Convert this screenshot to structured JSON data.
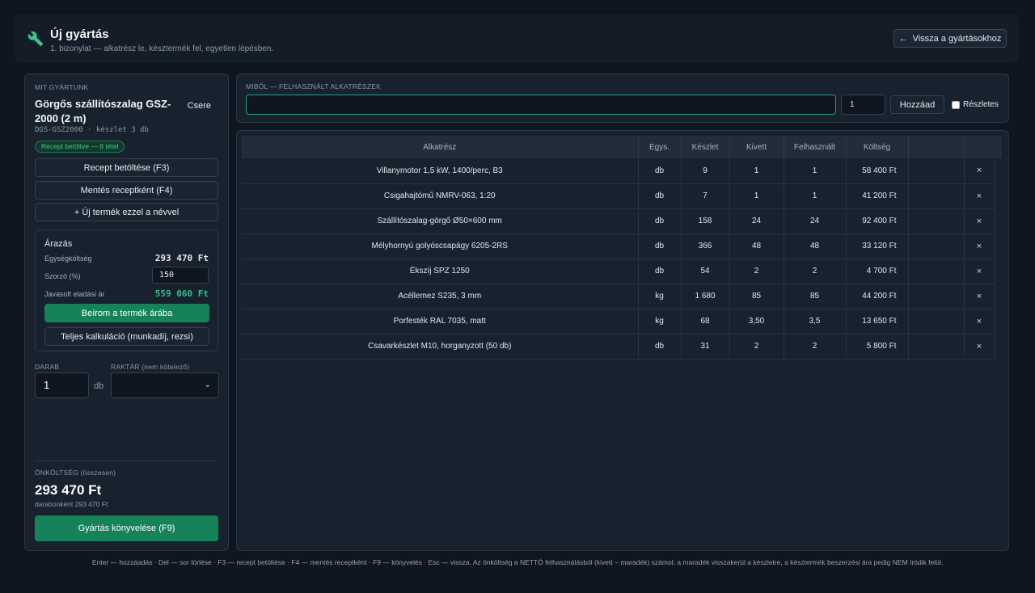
{
  "header": {
    "title": "Új gyártás",
    "subtitle": "1. bizonylat — alkatrész le, késztermék fel, egyetlen lépésben.",
    "back_label": "Vissza a gyártásokhoz"
  },
  "product": {
    "section_label": "MIT GYÁRTUNK",
    "name": "Görgős szállítószalag GSZ-2000 (2 m)",
    "change_label": "Csere",
    "code_line": "DGS-GSZ2000 · készlet 3 db",
    "badge": "Recept betöltve — 8 tétel"
  },
  "actions": {
    "load_recipe": "Recept betöltése (F3)",
    "save_recipe": "Mentés receptként (F4)",
    "new_product": "+ Új termék ezzel a névvel"
  },
  "pricing": {
    "title": "Árazás",
    "unit_cost_label": "Egységköltség",
    "unit_cost": "293 470 Ft",
    "multiplier_label": "Szorzó (%)",
    "multiplier": "150",
    "suggested_label": "Javasolt eladási ár",
    "suggested": "559 060 Ft",
    "apply_label": "Beírom a termék árába",
    "full_calc_label": "Teljes kalkuláció (munkadíj, rezsi)"
  },
  "quantity": {
    "label": "DARAB",
    "value": "1",
    "unit": "db",
    "warehouse_label": "RAKTÁR (nem kötelező)"
  },
  "summary": {
    "label": "ÖNKÖLTSÉG (összesen)",
    "total": "293 470 Ft",
    "per_unit": "darabonként 293 470 Ft",
    "post_label": "Gyártás könyvelése (F9)"
  },
  "parts": {
    "label": "MIBŐL — FELHASZNÁLT ALKATRÉSZEK",
    "qty": "1",
    "add_label": "Hozzáad",
    "detail_label": "Részletes"
  },
  "table": {
    "columns": [
      "Alkatrész",
      "Egys.",
      "Készlet",
      "Kivett",
      "Felhasznált",
      "Költség"
    ],
    "rows": [
      {
        "name": "Villanymotor 1,5 kW, 1400/perc, B3",
        "unit": "db",
        "stock": "9",
        "taken": "1",
        "used": "1",
        "cost": "58 400 Ft"
      },
      {
        "name": "Csigahajtómű NMRV-063, 1:20",
        "unit": "db",
        "stock": "7",
        "taken": "1",
        "used": "1",
        "cost": "41 200 Ft"
      },
      {
        "name": "Szállítószalag-görgő Ø50×600 mm",
        "unit": "db",
        "stock": "158",
        "taken": "24",
        "used": "24",
        "cost": "92 400 Ft"
      },
      {
        "name": "Mélyhornyú golyóscsapágy 6205-2RS",
        "unit": "db",
        "stock": "366",
        "taken": "48",
        "used": "48",
        "cost": "33 120 Ft"
      },
      {
        "name": "Ékszíj SPZ 1250",
        "unit": "db",
        "stock": "54",
        "taken": "2",
        "used": "2",
        "cost": "4 700 Ft"
      },
      {
        "name": "Acéllemez S235, 3 mm",
        "unit": "kg",
        "stock": "1 680",
        "taken": "85",
        "used": "85",
        "cost": "44 200 Ft"
      },
      {
        "name": "Porfesték RAL 7035, matt",
        "unit": "kg",
        "stock": "68",
        "taken": "3,50",
        "used": "3,5",
        "cost": "13 650 Ft"
      },
      {
        "name": "Csavarkészlet M10, horganyzott (50 db)",
        "unit": "db",
        "stock": "31",
        "taken": "2",
        "used": "2",
        "cost": "5 800 Ft"
      }
    ],
    "delete_glyph": "×"
  },
  "footer": "Enter — hozzáadás · Del — sor törlése · F3 — recept betöltése · F4 — mentés receptként · F9 — könyvelés · Esc — vissza. Az önköltség a NETTÓ felhasználásból (kivett − maradék) számol; a maradék visszakerül a készletre, a késztermék beszerzési ára pedig NEM íródik felül.",
  "colors": {
    "accent": "#16825a",
    "badge": "#43c98c",
    "price": "#2fbf87"
  }
}
